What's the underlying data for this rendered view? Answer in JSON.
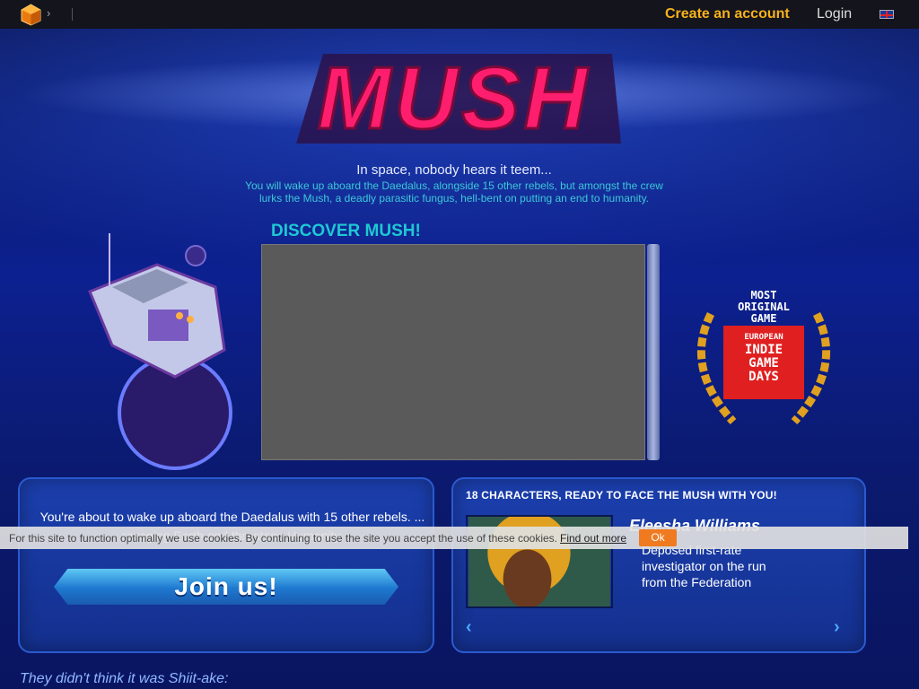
{
  "topbar": {
    "create_account": "Create an account",
    "login": "Login",
    "chevron": "›"
  },
  "header": {
    "logo_text": "MUSH",
    "tagline": "In space, nobody hears it teem...",
    "subtagline": "You will wake up aboard the Daedalus, alongside 15 other rebels, but amongst the crew lurks the Mush, a deadly parasitic fungus, hell-bent on putting an end to humanity."
  },
  "video": {
    "title": "DISCOVER MUSH!"
  },
  "award": {
    "line1": "MOST",
    "line2": "ORIGINAL",
    "line3": "GAME",
    "badge1": "EUROPEAN",
    "badge2": "INDIE",
    "badge3": "GAME",
    "badge4": "DAYS"
  },
  "join_panel": {
    "text": "You're about to wake up aboard the Daedalus with 15 other rebels. ... ravaging Earth and threatens Humanity.",
    "button": "Join us!"
  },
  "characters_panel": {
    "title": "18 CHARACTERS, READY TO FACE THE MUSH WITH YOU!",
    "character_name": "Eleesha Williams",
    "character_desc": "Deposed first-rate investigator on the run from the Federation",
    "prev": "‹",
    "next": "›"
  },
  "quote": "They didn't think it was Shiit-ake:",
  "cookie": {
    "text": "For this site to function optimally we use cookies. By continuing to use the site you accept the use of these cookies.",
    "link": "Find out more",
    "ok": "Ok"
  },
  "colors": {
    "accent_orange": "#f7b21a",
    "logo_pink": "#ff1e6e",
    "cyan": "#1ec8d4",
    "panel_blue": "#1b3fae"
  }
}
